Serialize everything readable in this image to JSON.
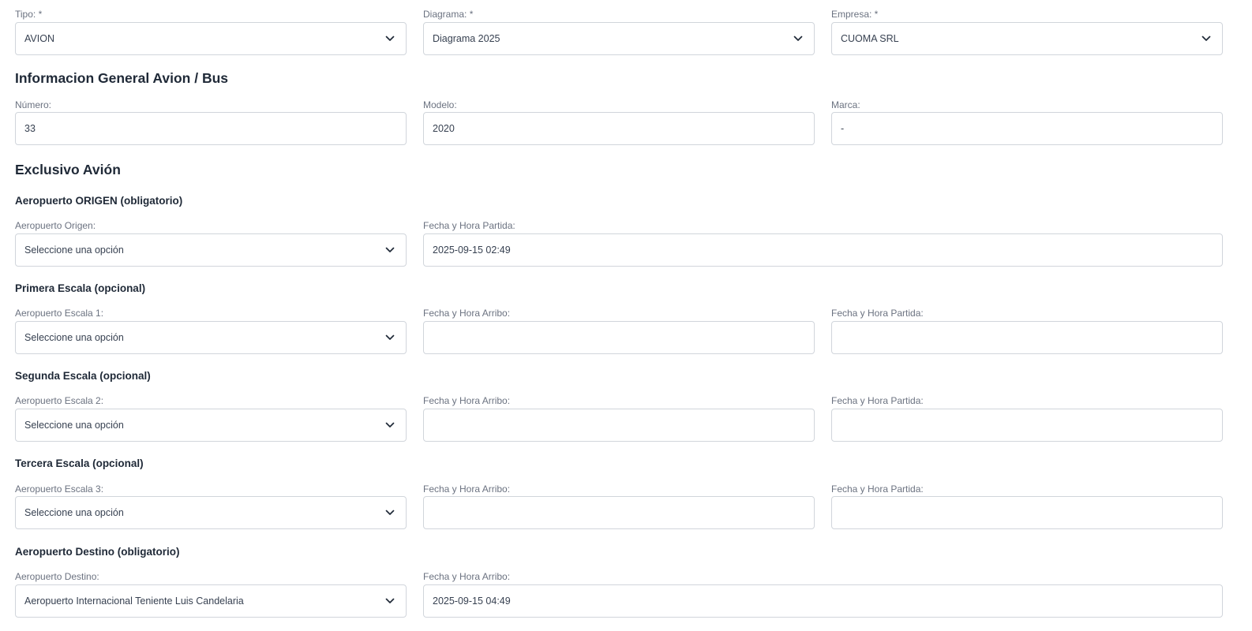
{
  "top": {
    "tipo": {
      "label": "Tipo: *",
      "value": "AVION"
    },
    "diagrama": {
      "label": "Diagrama: *",
      "value": "Diagrama 2025"
    },
    "empresa": {
      "label": "Empresa: *",
      "value": "CUOMA SRL"
    }
  },
  "general": {
    "title": "Informacion General Avion / Bus",
    "numero": {
      "label": "Número:",
      "value": "33"
    },
    "modelo": {
      "label": "Modelo:",
      "value": "2020"
    },
    "marca": {
      "label": "Marca:",
      "value": "-"
    }
  },
  "avion": {
    "title": "Exclusivo Avión",
    "origen": {
      "title": "Aeropuerto ORIGEN (obligatorio)",
      "airport_label": "Aeropuerto Origen:",
      "airport_value": "Seleccione una opción",
      "partida_label": "Fecha y Hora Partida:",
      "partida_value": "2025-09-15 02:49"
    },
    "escala1": {
      "title": "Primera Escala (opcional)",
      "airport_label": "Aeropuerto Escala 1:",
      "airport_value": "Seleccione una opción",
      "arribo_label": "Fecha y Hora Arribo:",
      "arribo_value": "",
      "partida_label": "Fecha y Hora Partida:",
      "partida_value": ""
    },
    "escala2": {
      "title": "Segunda Escala (opcional)",
      "airport_label": "Aeropuerto Escala 2:",
      "airport_value": "Seleccione una opción",
      "arribo_label": "Fecha y Hora Arribo:",
      "arribo_value": "",
      "partida_label": "Fecha y Hora Partida:",
      "partida_value": ""
    },
    "escala3": {
      "title": "Tercera Escala (opcional)",
      "airport_label": "Aeropuerto Escala 3:",
      "airport_value": "Seleccione una opción",
      "arribo_label": "Fecha y Hora Arribo:",
      "arribo_value": "",
      "partida_label": "Fecha y Hora Partida:",
      "partida_value": ""
    },
    "destino": {
      "title": "Aeropuerto Destino (obligatorio)",
      "airport_label": "Aeropuerto Destino:",
      "airport_value": "Aeropuerto Internacional Teniente Luis Candelaria",
      "arribo_label": "Fecha y Hora Arribo:",
      "arribo_value": "2025-09-15 04:49"
    }
  },
  "icons": {
    "select_arrow": "chevron-down-icon"
  }
}
